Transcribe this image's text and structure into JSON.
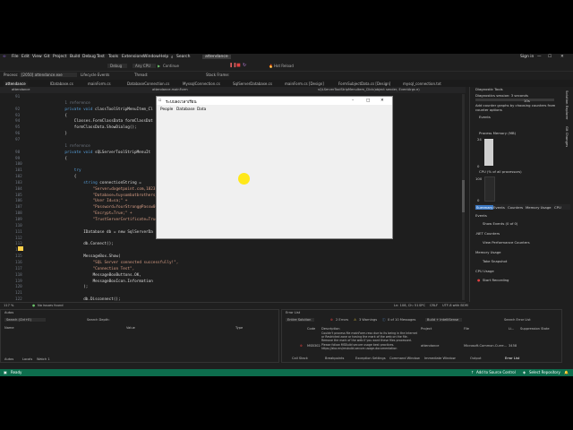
{
  "menu": {
    "items": [
      "File",
      "Edit",
      "View",
      "Git",
      "Project",
      "Build",
      "Debug",
      "Test",
      "Tools",
      "Extensions",
      "Window",
      "Help",
      "Search"
    ],
    "app_title": "attendance",
    "sign_in": "Sign in"
  },
  "toolbar": {
    "debug_config": "Debug",
    "platform": "Any CPU",
    "continue_label": "Continue",
    "hot_reload": "Hot Reload"
  },
  "process_bar": {
    "label": "Process:",
    "value": "[2050] attendance.exe",
    "lifecycle": "Lifecycle Events",
    "thread": "Thread:",
    "stack": "Stack Frame:"
  },
  "tabs": [
    {
      "label": "attendance"
    },
    {
      "label": "IDatabase.cs"
    },
    {
      "label": "mainForm.cs"
    },
    {
      "label": "DatabaseConnection.cs"
    },
    {
      "label": "MyssqlConnection.cs"
    },
    {
      "label": "SqlServerDatabase.cs"
    },
    {
      "label": "mainForm.cs [Design]"
    },
    {
      "label": "FormSubjectData.cs [Design]"
    },
    {
      "label": "mysql_connection.txt"
    }
  ],
  "editor": {
    "file_label": "attendance",
    "breadcrumb": "attendance.mainForm",
    "method_breadcrumb": "sQLServerToolStripMenuItem_Click(object sender, EventArgs e)",
    "lines": [
      {
        "n": "91",
        "text": ""
      },
      {
        "n": "",
        "text": "1 reference",
        "cls": "cm",
        "ind": 4
      },
      {
        "n": "92",
        "text": "private void classToolStripMenuItem_Cl",
        "ind": 4
      },
      {
        "n": "93",
        "text": "{",
        "ind": 4
      },
      {
        "n": "94",
        "text": "Classes.FormClassData formClassDat",
        "ind": 8
      },
      {
        "n": "95",
        "text": "formClassData.ShowDialog();",
        "ind": 8
      },
      {
        "n": "96",
        "text": "}",
        "ind": 4
      },
      {
        "n": "97",
        "text": ""
      },
      {
        "n": "",
        "text": "1 reference",
        "cls": "cm",
        "ind": 4
      },
      {
        "n": "98",
        "text": "private void sQLServerToolStripMenuIt",
        "ind": 4
      },
      {
        "n": "99",
        "text": "{",
        "ind": 4
      },
      {
        "n": "100",
        "text": ""
      },
      {
        "n": "101",
        "text": "try",
        "ind": 8
      },
      {
        "n": "102",
        "text": "{",
        "ind": 8
      },
      {
        "n": "103",
        "text": "string connectionString =",
        "ind": 12
      },
      {
        "n": "104",
        "text": "\"Server=dxgetpoint.com,1823;\"",
        "ind": 16
      },
      {
        "n": "105",
        "text": "\"Database=tuysombatbrothers_8\"",
        "ind": 16
      },
      {
        "n": "106",
        "text": "\"User Id=sa;\" +",
        "ind": 16
      },
      {
        "n": "107",
        "text": "\"Password=YourStrong@Passw0rd\"",
        "ind": 16
      },
      {
        "n": "108",
        "text": "\"Encrypt=True;\" +",
        "ind": 16
      },
      {
        "n": "109",
        "text": "\"TrustServerCertificate=True;\"",
        "ind": 16
      },
      {
        "n": "110",
        "text": ""
      },
      {
        "n": "111",
        "text": "IDatabase db = new SqlServerDa",
        "ind": 12
      },
      {
        "n": "112",
        "text": ""
      },
      {
        "n": "113",
        "text": "db.Connect();",
        "ind": 12
      },
      {
        "n": "114",
        "text": ""
      },
      {
        "n": "115",
        "text": "MessageBox.Show(",
        "ind": 12
      },
      {
        "n": "116",
        "text": "\"SQL Server connected successfully!\",",
        "ind": 16
      },
      {
        "n": "117",
        "text": "\"Connection Test\",",
        "ind": 16
      },
      {
        "n": "118",
        "text": "MessageBoxButtons.OK,",
        "ind": 16
      },
      {
        "n": "119",
        "text": "MessageBoxIcon.Information",
        "ind": 16
      },
      {
        "n": "120",
        "text": ");",
        "ind": 12
      },
      {
        "n": "121",
        "text": ""
      },
      {
        "n": "122",
        "text": "db.Disconnect();",
        "ind": 12
      }
    ],
    "zoom": "117 %",
    "issues": "No issues found",
    "position": "Ln: 108, Ch: 51",
    "spc": "SPC",
    "crlf": "CRLF",
    "encoding": "UTF-8 with BOM"
  },
  "form": {
    "title": "ระบบลงเวลาเรียน",
    "menu": [
      "People",
      "Database",
      "Data"
    ]
  },
  "diagnostics": {
    "title": "Diagnostic Tools",
    "session": "Diagnostics session: 3 seconds",
    "tick": "10s",
    "hint": "Add counter graphs by choosing counters from counter options",
    "events": "Events",
    "memory": "Process Memory (MB)",
    "mem_max": "24",
    "mem_min": "0",
    "cpu": "CPU (% of all processors)",
    "cpu_max": "100",
    "cpu_min": "0",
    "tabs": [
      "Summary",
      "Events",
      "Counters",
      "Memory Usage",
      "CPU"
    ],
    "events_section": "Events",
    "show_events": "Show Events (0 of 0)",
    "net_counters": ".NET Counters",
    "view_perf": "View Performance Counters",
    "memory_usage": "Memory Usage",
    "take_snapshot": "Take Snapshot",
    "cpu_usage": "CPU Usage",
    "start_recording": "Start Recording",
    "side_tabs": [
      "Solution Explorer",
      "Git Changes"
    ]
  },
  "autos": {
    "title": "Autos",
    "search": "Search (Ctrl+E)",
    "depth": "Search Depth:",
    "cols": [
      "Name",
      "Value",
      "Type"
    ],
    "tabs": [
      "Autos",
      "Locals",
      "Watch 1"
    ]
  },
  "errors": {
    "title": "Error List",
    "scope": "Entire Solution",
    "errors": "2 Errors",
    "warnings": "3 Warnings",
    "messages": "0 of 10 Messages",
    "build": "Build + IntelliSense",
    "search": "Search Error List",
    "cols": [
      "Code",
      "Description",
      "Project",
      "File",
      "Li...",
      "Suppression State"
    ],
    "row": {
      "code": "MSB302",
      "desc": "Couldn't process file mainForm.resx due to its being in the Internet or Restricted zone or having the mark of the web on the file. Remove the mark of the web if you want these files processed. Please follow MSBuild secure usage best practices. https://aka.ms/msbuild-secure-usage-documentation",
      "project": "attendance",
      "file": "Microsoft.Common.Curre...",
      "line": "3458"
    },
    "tabs": [
      "Call Stack",
      "Breakpoints",
      "Exception Settings",
      "Command Window",
      "Immediate Window",
      "Output",
      "Error List"
    ]
  },
  "statusbar": {
    "ready": "Ready",
    "source_control": "Add to Source Control",
    "repo": "Select Repository"
  },
  "colors": {
    "statusbar": "#0d6d4d",
    "cursor_highlight": "#ffe81a",
    "editor_bg": "#1e1e1e"
  }
}
